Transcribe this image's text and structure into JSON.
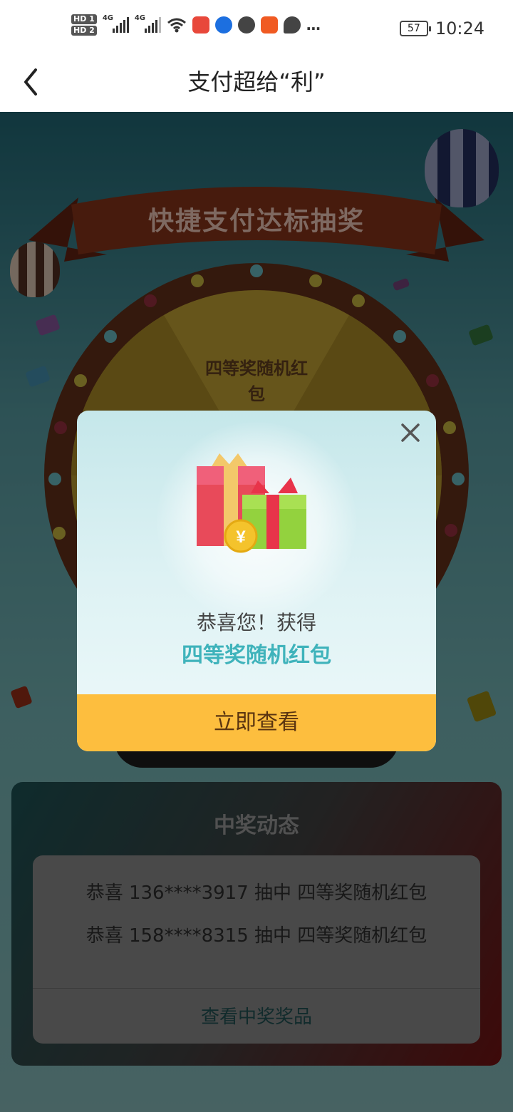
{
  "status_bar": {
    "sim1": "HD 1",
    "sim2": "HD 2",
    "net1": "4G",
    "net2": "4G",
    "battery": "57",
    "time": "10:24",
    "more": "…"
  },
  "nav": {
    "back_label": "‹",
    "title": "支付超给“利”"
  },
  "background": {
    "banner_title": "快捷支付达标抽奖",
    "wheel_top_label": "四等奖随机红包"
  },
  "feed": {
    "title": "中奖动态",
    "items": [
      "恭喜 136****3917 抽中 四等奖随机红包",
      "恭喜 158****8315 抽中 四等奖随机红包"
    ],
    "link": "查看中奖奖品"
  },
  "modal": {
    "close_label": "×",
    "coin_symbol": "¥",
    "congrats": "恭喜您！获得",
    "prize": "四等奖随机红包",
    "cta": "立即查看"
  }
}
